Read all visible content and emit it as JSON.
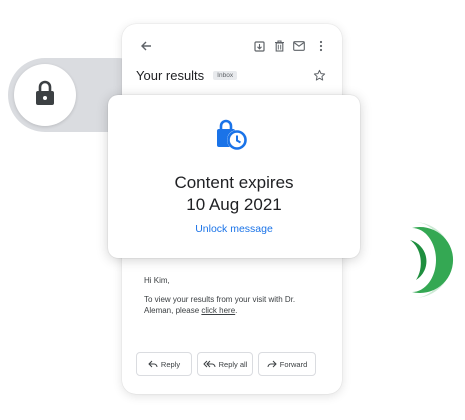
{
  "colors": {
    "accent_blue": "#1a73e8",
    "text_dark": "#202124",
    "text_gray": "#5f6368",
    "green": "#34a853",
    "green_dark": "#1e8e3e",
    "pill_gray": "#dadce0"
  },
  "icons": {
    "lock": "lock-icon",
    "back": "arrow-left-icon",
    "archive": "archive-icon",
    "delete": "trash-icon",
    "mail": "mail-icon",
    "more": "more-vert-icon",
    "star": "star-outline-icon",
    "expiry": "clock-lock-icon",
    "reply": "reply-icon",
    "reply_all": "reply-all-icon",
    "forward": "forward-icon"
  },
  "email": {
    "subject": "Your results",
    "label": "Inbox",
    "greeting": "Hi Kim,",
    "body_prefix": "To view your results from your visit with Dr. Aleman, please",
    "body_link": "click here",
    "body_suffix": "."
  },
  "expiry": {
    "title": "Content expires",
    "date": "10 Aug 2021",
    "unlock_label": "Unlock message"
  },
  "actions": {
    "reply_label": "Reply",
    "reply_all_label": "Reply all",
    "forward_label": "Forward"
  }
}
